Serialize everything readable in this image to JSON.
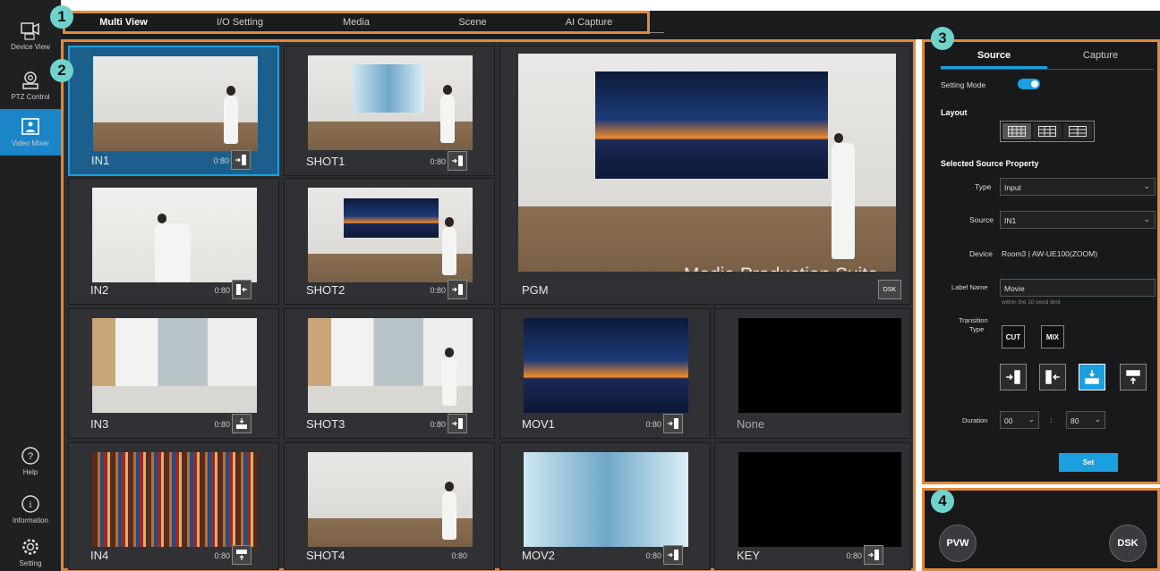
{
  "sidebar": {
    "items": [
      {
        "label": "Device View",
        "icon": "device-view-icon"
      },
      {
        "label": "PTZ Control",
        "icon": "ptz-camera-icon"
      },
      {
        "label": "Video Mixer",
        "icon": "video-mixer-icon",
        "active": true
      },
      {
        "label": "Help",
        "icon": "help-icon"
      },
      {
        "label": "Information",
        "icon": "info-icon"
      },
      {
        "label": "Setting",
        "icon": "gear-icon"
      }
    ]
  },
  "tabs": [
    "Multi View",
    "I/O Setting",
    "Media",
    "Scene",
    "AI Capture"
  ],
  "callouts": [
    "1",
    "2",
    "3",
    "4"
  ],
  "multiview": {
    "cells": [
      {
        "name": "IN1",
        "duration": "0:80",
        "transition": "wipe-right"
      },
      {
        "name": "SHOT1",
        "duration": "0:80",
        "transition": "wipe-right"
      },
      {
        "name": "IN2",
        "duration": "0:80",
        "transition": "wipe-left"
      },
      {
        "name": "SHOT2",
        "duration": "0:80",
        "transition": "wipe-right"
      },
      {
        "name": "IN3",
        "duration": "0:80",
        "transition": "wipe-down"
      },
      {
        "name": "SHOT3",
        "duration": "0:80",
        "transition": "wipe-right"
      },
      {
        "name": "MOV1",
        "duration": "0:80",
        "transition": "wipe-right"
      },
      {
        "name": "None",
        "duration": "",
        "transition": ""
      },
      {
        "name": "IN4",
        "duration": "0:80",
        "transition": "wipe-up"
      },
      {
        "name": "SHOT4",
        "duration": "0:80",
        "transition": ""
      },
      {
        "name": "MOV2",
        "duration": "0:80",
        "transition": "wipe-right"
      },
      {
        "name": "KEY",
        "duration": "0:80",
        "transition": "wipe-right"
      }
    ],
    "pgm": {
      "name": "PGM",
      "caption": "Media Production Suite",
      "dsk_label": "DSK"
    }
  },
  "panel": {
    "tabs": [
      "Source",
      "Capture"
    ],
    "setting_mode_label": "Setting Mode",
    "setting_mode_on": true,
    "layout_label": "Layout",
    "selected_source_label": "Selected Source Property",
    "type_label": "Type",
    "type_value": "Input",
    "source_label": "Source",
    "source_value": "IN1",
    "device_label": "Device",
    "device_value": "Room3 | AW-UE100(ZOOM)",
    "label_name_label": "Label Name",
    "label_name_value": "Movie",
    "label_name_hint": "within the 10 word limit",
    "transition_label_1": "Transition",
    "transition_label_2": "Type",
    "cut_label": "CUT",
    "mix_label": "MIX",
    "duration_label": "Duration",
    "duration_sec": "00",
    "duration_frames": "80",
    "duration_sep": ":",
    "set_label": "Set"
  },
  "bottom": {
    "pvw_label": "PVW",
    "dsk_label": "DSK"
  },
  "colors": {
    "accent": "#1a9fe0",
    "callout_border": "#e08a3c",
    "badge": "#6fd3cc"
  }
}
